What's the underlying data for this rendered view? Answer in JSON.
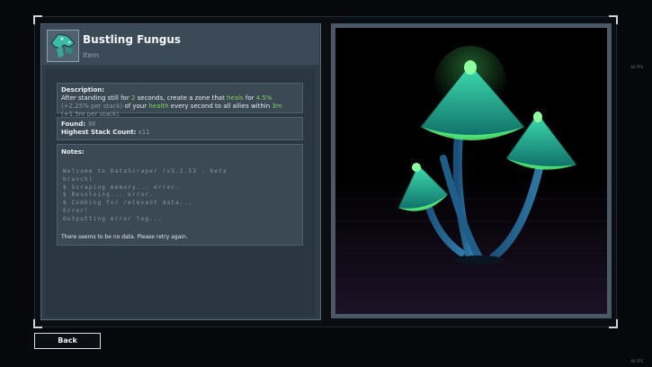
{
  "item": {
    "name": "Bustling Fungus",
    "type": "Item",
    "icon": "mushroom-icon"
  },
  "description": {
    "label": "Description:",
    "parts": [
      {
        "text": "After standing still for ",
        "style": "normal"
      },
      {
        "text": "2",
        "style": "green"
      },
      {
        "text": " seconds, create a zone that ",
        "style": "normal"
      },
      {
        "text": "heals",
        "style": "green"
      },
      {
        "text": " for ",
        "style": "normal"
      },
      {
        "text": "4.5%",
        "style": "green"
      },
      {
        "text": " (+2.25% per stack)",
        "style": "muted"
      },
      {
        "text": " of your ",
        "style": "normal"
      },
      {
        "text": "health",
        "style": "green"
      },
      {
        "text": " every second to all allies within ",
        "style": "normal"
      },
      {
        "text": "3m",
        "style": "green"
      },
      {
        "text": " (+1.5m per stack).",
        "style": "muted"
      }
    ]
  },
  "stats": {
    "found_label": "Found:",
    "found_value": "38",
    "stack_label": "Highest Stack Count:",
    "stack_value": "x11"
  },
  "notes": {
    "label": "Notes:",
    "log_lines": [
      "Welcome to DataScraper (v3.1.53 - beta",
      "branch)",
      "$ Scraping memory... error.",
      "$ Resolving... error.",
      "$ Combing for relevant data...",
      "Error!",
      "Outputting error log..."
    ],
    "message": "There seems to be no data. Please retry again."
  },
  "back_button": "Back",
  "fps_label": "60 FPS",
  "colors": {
    "accent_green": "#7fd35a",
    "panel": "#2f3d48",
    "mushroom_cap": "#1e9c8c",
    "mushroom_glow": "#5cff7a"
  }
}
